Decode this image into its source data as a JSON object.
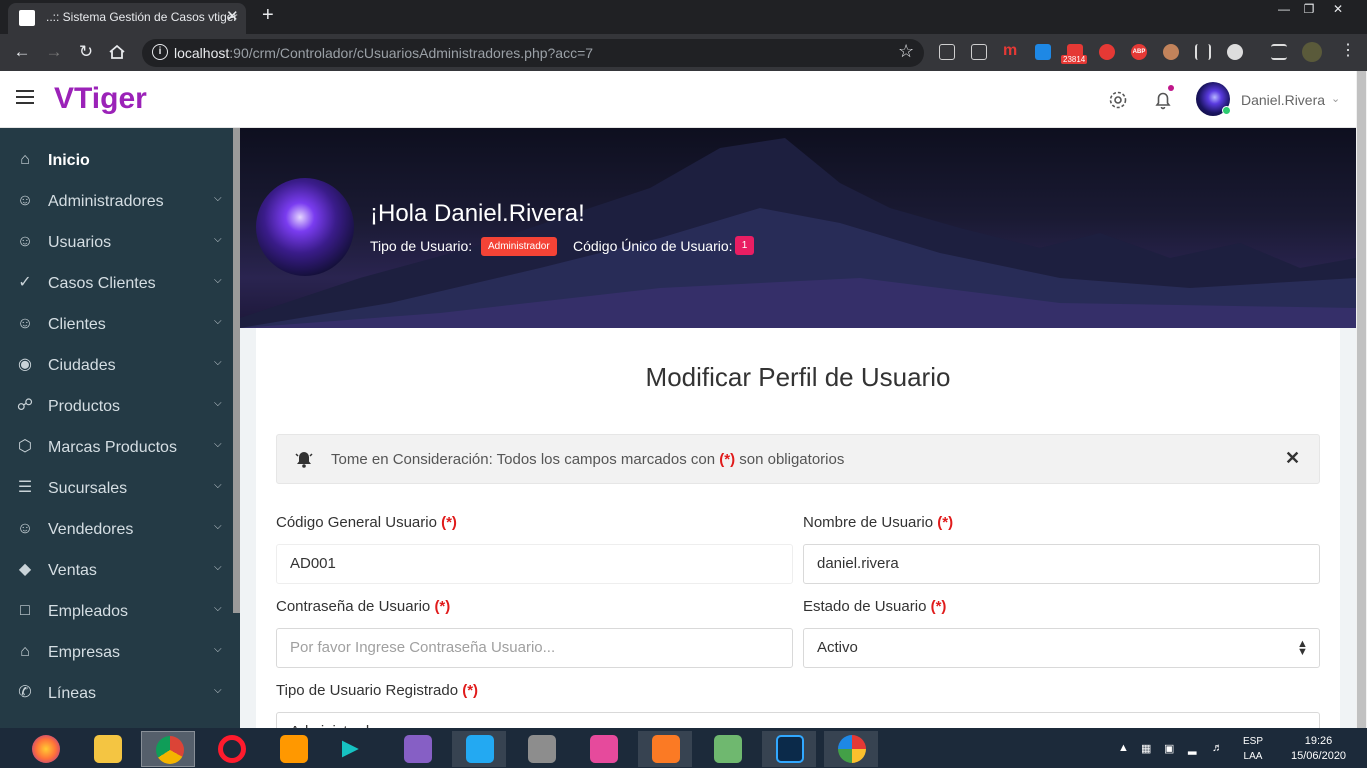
{
  "browser": {
    "tab_title": "..:: Sistema Gestión de Casos vtiger",
    "tab_close": "✕",
    "new_tab": "+",
    "url_host": "localhost",
    "url_rest": ":90/crm/Controlador/cUsuariosAdministradores.php?acc=7",
    "ext_badge": "23814",
    "ext_abp": "ABP"
  },
  "header": {
    "brand": "VTiger",
    "username": "Daniel.Rivera"
  },
  "sidebar": {
    "items": [
      {
        "label": "Inicio",
        "icon": "home-icon"
      },
      {
        "label": "Administradores",
        "icon": "user-x-icon"
      },
      {
        "label": "Usuarios",
        "icon": "user-check-icon"
      },
      {
        "label": "Casos Clientes",
        "icon": "check-circle-icon"
      },
      {
        "label": "Clientes",
        "icon": "users-icon"
      },
      {
        "label": "Ciudades",
        "icon": "map-pin-icon"
      },
      {
        "label": "Productos",
        "icon": "cart-icon"
      },
      {
        "label": "Marcas Productos",
        "icon": "box-icon"
      },
      {
        "label": "Sucursales",
        "icon": "layers-icon"
      },
      {
        "label": "Vendedores",
        "icon": "user-plus-icon"
      },
      {
        "label": "Ventas",
        "icon": "tag-icon"
      },
      {
        "label": "Empleados",
        "icon": "folder-icon"
      },
      {
        "label": "Empresas",
        "icon": "home-icon"
      },
      {
        "label": "Líneas",
        "icon": "phone-icon"
      }
    ]
  },
  "banner": {
    "greeting": "¡Hola Daniel.Rivera!",
    "tipo_label": "Tipo de Usuario:",
    "tipo_value": "Administrador",
    "codigo_label": "Código Único de Usuario:",
    "codigo_value": "1"
  },
  "form": {
    "title": "Modificar Perfil de Usuario",
    "alert_prefix": "Tome en Consideración: Todos los campos marcados con",
    "alert_req": "(*)",
    "alert_suffix": "son obligatorios",
    "alert_close": "✕",
    "required_mark": "(*)",
    "codigo_label": "Código General Usuario",
    "codigo_value": "AD001",
    "nombre_label": "Nombre de Usuario",
    "nombre_value": "daniel.rivera",
    "password_label": "Contraseña de Usuario",
    "password_placeholder": "Por favor Ingrese Contraseña Usuario...",
    "estado_label": "Estado de Usuario",
    "estado_value": "Activo",
    "tipo_label": "Tipo de Usuario Registrado",
    "tipo_value": "Administrador"
  },
  "taskbar": {
    "lang_top": "ESP",
    "lang_bottom": "LAA",
    "time": "19:26",
    "date": "15/06/2020"
  },
  "colors": {
    "brand": "#9b22b8",
    "sidebar_bg": "#243a45",
    "badge_red": "#f44336",
    "badge_pink": "#e91e63",
    "required": "#e01b1b"
  }
}
